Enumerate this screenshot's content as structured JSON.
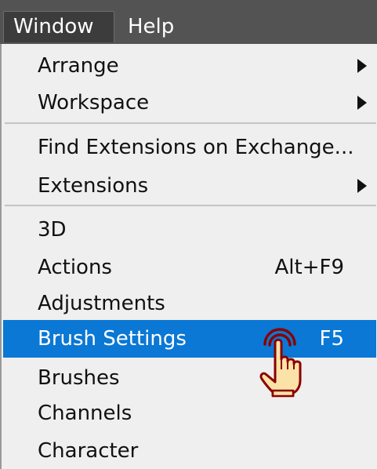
{
  "menubar": {
    "items": [
      {
        "label": "Window"
      },
      {
        "label": "Help"
      }
    ]
  },
  "menu": {
    "items": [
      {
        "label": "Arrange",
        "submenu": true
      },
      {
        "label": "Workspace",
        "submenu": true
      },
      {
        "label": "Find Extensions on Exchange..."
      },
      {
        "label": "Extensions",
        "submenu": true
      },
      {
        "label": "3D"
      },
      {
        "label": "Actions",
        "shortcut": "Alt+F9"
      },
      {
        "label": "Adjustments"
      },
      {
        "label": "Brush Settings",
        "shortcut": "F5",
        "highlighted": true
      },
      {
        "label": "Brushes"
      },
      {
        "label": "Channels"
      },
      {
        "label": "Character"
      }
    ]
  },
  "colors": {
    "menubar_bg": "#535353",
    "menu_bg": "#efefef",
    "highlight": "#0a78d4",
    "cursor_fill": "#fbe3a7",
    "cursor_outline": "#8b0000"
  },
  "cursor": {
    "icon": "hand-pointer-icon"
  }
}
